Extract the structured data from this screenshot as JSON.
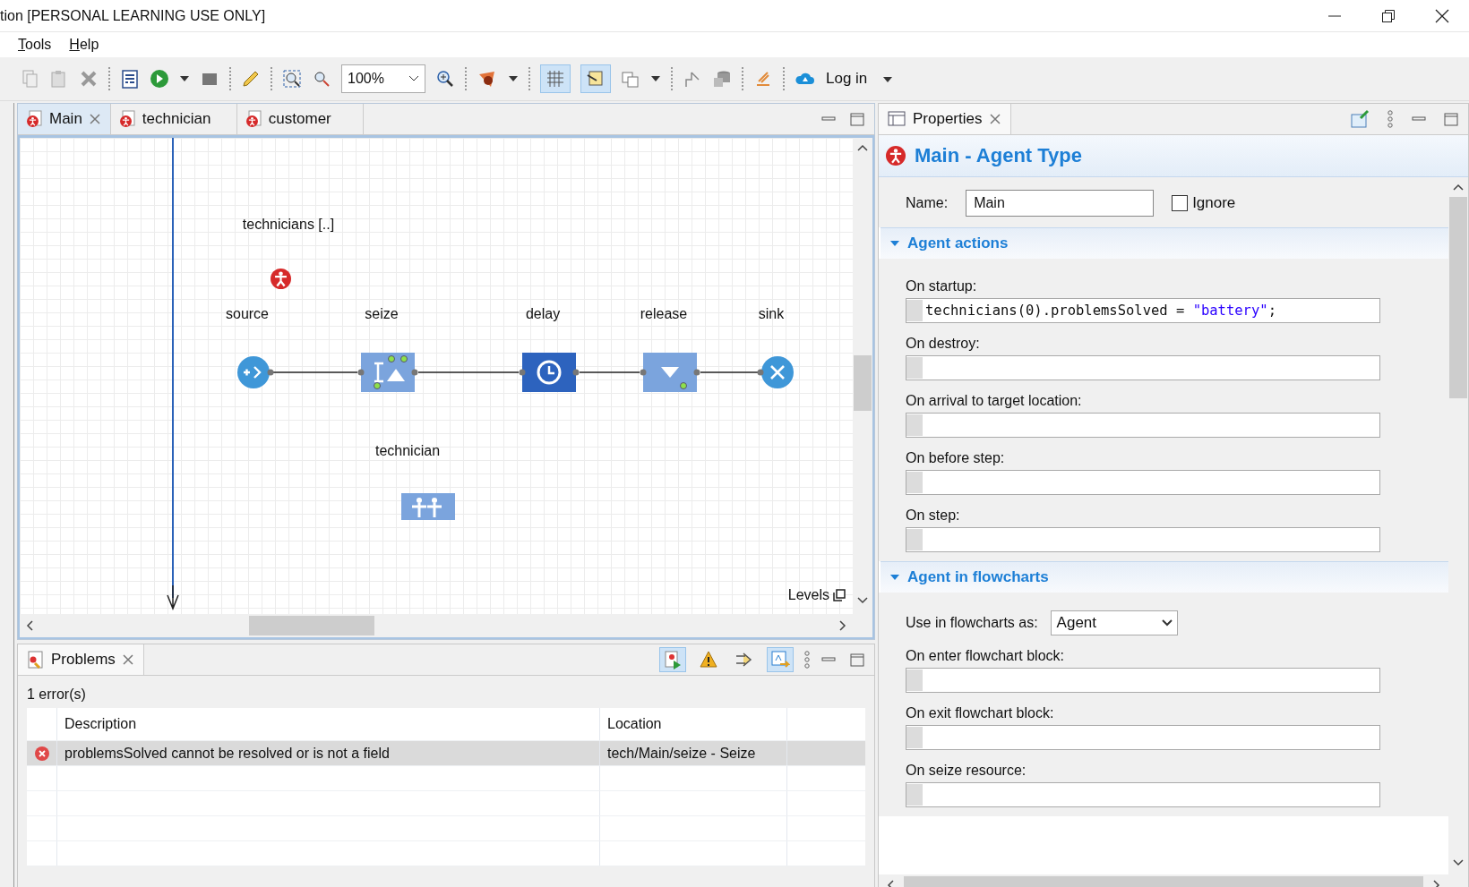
{
  "window": {
    "title": "tion [PERSONAL LEARNING USE ONLY]"
  },
  "menu": [
    {
      "label": "Tools"
    },
    {
      "label": "Help"
    }
  ],
  "toolbar": {
    "zoom": "100%",
    "login": "Log in",
    "toggles": [
      {
        "kind": "grid",
        "pressed": true
      },
      {
        "kind": "snap",
        "pressed": true
      }
    ]
  },
  "editor": {
    "tabs": [
      {
        "label": "Main",
        "selected": true
      },
      {
        "label": "technician",
        "selected": false
      },
      {
        "label": "customer",
        "selected": false
      }
    ],
    "diagram": {
      "population_label": "technicians [..]",
      "resource_label": "technician",
      "levels": "Levels",
      "blocks": [
        {
          "label": "source",
          "kind": "source"
        },
        {
          "label": "seize",
          "kind": "seize"
        },
        {
          "label": "delay",
          "kind": "delay"
        },
        {
          "label": "release",
          "kind": "release"
        },
        {
          "label": "sink",
          "kind": "sink"
        }
      ]
    }
  },
  "problems": {
    "title": "Problems",
    "summary": "1 error(s)",
    "toggles": [
      {
        "kind": "errors",
        "pressed": true
      },
      {
        "kind": "warnings",
        "pressed": false
      },
      {
        "kind": "filter",
        "pressed": false
      },
      {
        "kind": "link",
        "pressed": true
      }
    ],
    "columns": [
      "Description",
      "Location"
    ],
    "rows": [
      {
        "description": "problemsSolved cannot be resolved or is not a field",
        "location": "tech/Main/seize - Seize",
        "selected": true
      }
    ]
  },
  "properties": {
    "title": "Properties",
    "heading": "Main - Agent Type",
    "name_label": "Name:",
    "name_value": "Main",
    "ignore": {
      "label": "Ignore",
      "checked": false
    },
    "sections": [
      {
        "title": "Agent actions",
        "expanded": true,
        "fields": [
          {
            "kind": "code",
            "label": "On startup:",
            "value": "technicians(0).problemsSolved = \"battery\";"
          },
          {
            "kind": "code",
            "label": "On destroy:"
          },
          {
            "kind": "code",
            "label": "On arrival to target location:"
          },
          {
            "kind": "code",
            "label": "On before step:"
          },
          {
            "kind": "code",
            "label": "On step:"
          }
        ]
      },
      {
        "title": "Agent in flowcharts",
        "expanded": true,
        "fields": [
          {
            "kind": "dropdown",
            "label": "Use in flowcharts as:",
            "value": "Agent"
          },
          {
            "kind": "code",
            "label": "On enter flowchart block:"
          },
          {
            "kind": "code",
            "label": "On exit flowchart block:"
          },
          {
            "kind": "code",
            "label": "On seize resource:"
          }
        ]
      }
    ]
  }
}
